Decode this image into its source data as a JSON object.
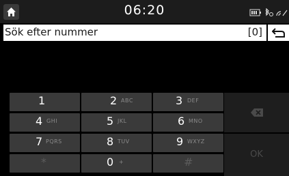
{
  "status_bar": {
    "time": "06:20"
  },
  "search": {
    "placeholder": "Sök efter nummer",
    "count": "[0]"
  },
  "keypad": {
    "keys": [
      {
        "digit": "1",
        "letters": ""
      },
      {
        "digit": "2",
        "letters": "ABC"
      },
      {
        "digit": "3",
        "letters": "DEF"
      },
      {
        "digit": "4",
        "letters": "GHI"
      },
      {
        "digit": "5",
        "letters": "JKL"
      },
      {
        "digit": "6",
        "letters": "MNO"
      },
      {
        "digit": "7",
        "letters": "PQRS"
      },
      {
        "digit": "8",
        "letters": "TUV"
      },
      {
        "digit": "9",
        "letters": "WXYZ"
      },
      {
        "digit": "*",
        "letters": ""
      },
      {
        "digit": "0",
        "letters": "+"
      },
      {
        "digit": "#",
        "letters": ""
      }
    ],
    "ok_label": "OK"
  },
  "colors": {
    "key_bg": "#3a3a3a",
    "side_key_bg": "#1e1e1e",
    "statusbar_bg": "#1c1c1c",
    "search_bg": "#ffffff"
  },
  "icons": [
    "home-icon",
    "battery-icon",
    "bluetooth-icon",
    "signal-icon",
    "back-arrow-icon",
    "backspace-icon"
  ]
}
